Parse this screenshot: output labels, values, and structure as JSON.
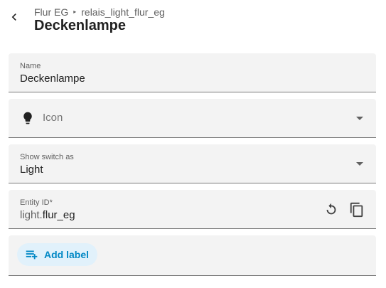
{
  "header": {
    "breadcrumb": {
      "area": "Flur EG",
      "separator": "▸",
      "device": "relais_light_flur_eg"
    },
    "title": "Deckenlampe",
    "back_icon": "chevron-left-icon"
  },
  "fields": {
    "name": {
      "label": "Name",
      "value": "Deckenlampe"
    },
    "icon": {
      "placeholder": "Icon",
      "icon": "lightbulb-icon"
    },
    "show_as": {
      "label": "Show switch as",
      "value": "Light"
    },
    "entity_id": {
      "label": "Entity ID*",
      "domain_prefix": "light.",
      "value": "flur_eg",
      "reset_icon": "restore-icon",
      "copy_icon": "copy-icon"
    },
    "labels": {
      "add_label": "Add label",
      "icon": "playlist-plus-icon"
    }
  },
  "colors": {
    "accent": "#0288c5",
    "accent_bg": "#e1f1fb",
    "field_bg": "#f3f3f3",
    "text": "#212121",
    "secondary_text": "#616161"
  }
}
